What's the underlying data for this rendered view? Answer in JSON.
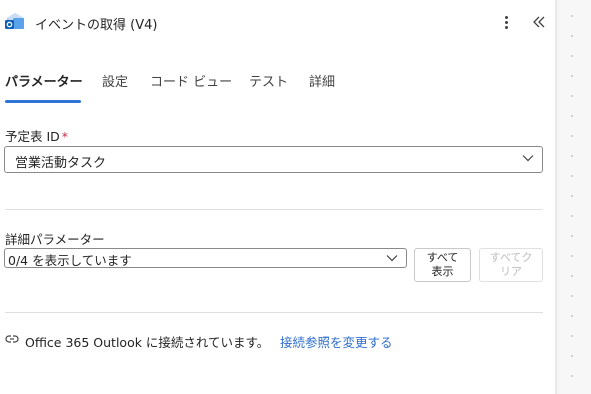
{
  "header": {
    "title": "イベントの取得 (V4)",
    "icon": "outlook-calendar-icon",
    "more_icon": "more-vertical-icon",
    "collapse_icon": "double-chevron-left-icon"
  },
  "tabs": [
    {
      "label": "パラメーター",
      "active": true
    },
    {
      "label": "設定",
      "active": false
    },
    {
      "label": "コード ビュー",
      "active": false
    },
    {
      "label": "テスト",
      "active": false
    },
    {
      "label": "詳細",
      "active": false
    }
  ],
  "calendar_field": {
    "label": "予定表 ID",
    "required_mark": "*",
    "value": "営業活動タスク"
  },
  "advanced": {
    "label": "詳細パラメーター",
    "dropdown_value": "0/4 を表示しています",
    "show_all_label": "すべて表示",
    "clear_all_label": "すべてクリア"
  },
  "connection": {
    "status_text": "Office 365 Outlook に接続されています。",
    "change_link": "接続参照を変更する"
  },
  "colors": {
    "accent": "#2d74d4",
    "link": "#2d6ed0",
    "required": "#c4314b"
  }
}
